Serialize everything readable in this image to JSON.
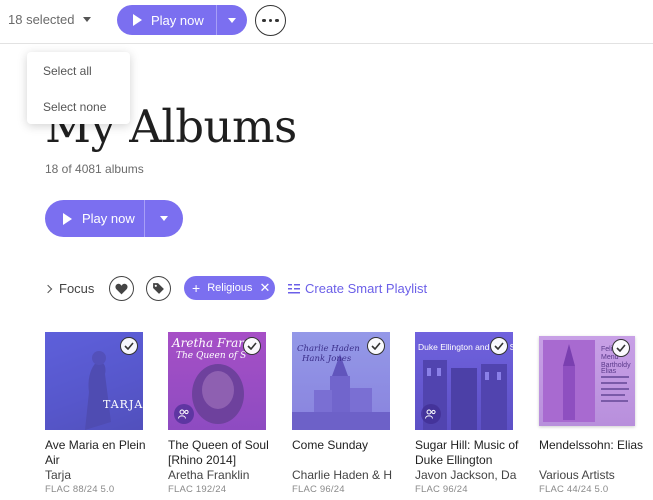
{
  "selection": {
    "count_label": "18 selected"
  },
  "toolbar": {
    "play_label": "Play now"
  },
  "menu": {
    "items": [
      "Select all",
      "Select none"
    ]
  },
  "page": {
    "title": "My Albums",
    "count": "18 of 4081 albums",
    "play_label": "Play now"
  },
  "filters": {
    "focus_label": "Focus",
    "chip_label": "Religious",
    "smart_playlist_label": "Create Smart Playlist"
  },
  "colors": {
    "accent": "#7b6ff0",
    "link": "#6b5fe8"
  },
  "albums": [
    {
      "title": "Ave Maria en Plein Air",
      "artist": "Tarja",
      "format": "FLAC 88/24 5.0",
      "cover_text": "TARJA"
    },
    {
      "title": "The Queen of Soul [Rhino 2014]",
      "artist": "Aretha Franklin",
      "format": "FLAC 192/24",
      "cover_text": "Aretha Frankl",
      "cover_sub": "The Queen of S"
    },
    {
      "title": "Come Sunday",
      "artist": "Charlie Haden & H",
      "format": "FLAC 96/24",
      "cover_text": "Charlie Haden",
      "cover_sub": "Hank Jones"
    },
    {
      "title": "Sugar Hill: Music of Duke Ellington",
      "artist": "Javon Jackson, Da",
      "format": "FLAC 96/24",
      "cover_text": "Duke Ellington and Billy S"
    },
    {
      "title": "Mendelssohn: Elias",
      "artist": "Various Artists",
      "format": "FLAC 44/24 5.0",
      "cover_text": "Felix Mend Bartholdy",
      "cover_sub": "Elias"
    }
  ]
}
